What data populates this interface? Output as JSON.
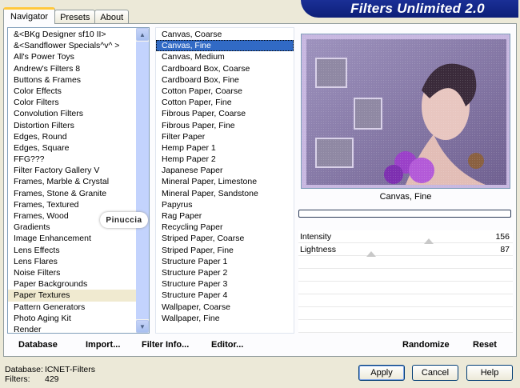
{
  "tabs": [
    {
      "label": "Navigator",
      "active": true
    },
    {
      "label": "Presets",
      "active": false
    },
    {
      "label": "About",
      "active": false
    }
  ],
  "banner": {
    "title": "Filters Unlimited 2.0"
  },
  "categories": {
    "items": [
      "&<BKg Designer sf10 II>",
      "&<Sandflower Specials^v^ >",
      "All's Power Toys",
      "Andrew's Filters 8",
      "Buttons & Frames",
      "Color Effects",
      "Color Filters",
      "Convolution Filters",
      "Distortion Filters",
      "Edges, Round",
      "Edges, Square",
      "FFG???",
      "Filter Factory Gallery V",
      "Frames, Marble & Crystal",
      "Frames, Stone & Granite",
      "Frames, Textured",
      "Frames, Wood",
      "Gradients",
      "Image Enhancement",
      "Lens Effects",
      "Lens Flares",
      "Noise Filters",
      "Paper Backgrounds",
      "Paper Textures",
      "Pattern Generators",
      "Photo Aging Kit",
      "Render"
    ],
    "selected_index": 23
  },
  "filters": {
    "items": [
      "Canvas, Coarse",
      "Canvas, Fine",
      "Canvas, Medium",
      "Cardboard Box, Coarse",
      "Cardboard Box, Fine",
      "Cotton Paper, Coarse",
      "Cotton Paper, Fine",
      "Fibrous Paper, Coarse",
      "Fibrous Paper, Fine",
      "Filter Paper",
      "Hemp Paper 1",
      "Hemp Paper 2",
      "Japanese Paper",
      "Mineral Paper, Limestone",
      "Mineral Paper, Sandstone",
      "Papyrus",
      "Rag Paper",
      "Recycling Paper",
      "Striped Paper, Coarse",
      "Striped Paper, Fine",
      "Structure Paper 1",
      "Structure Paper 2",
      "Structure Paper 3",
      "Structure Paper 4",
      "Wallpaper, Coarse",
      "Wallpaper, Fine"
    ],
    "selected_index": 1
  },
  "preview": {
    "caption": "Canvas, Fine",
    "progress_fraction": 0
  },
  "sliders": [
    {
      "label": "Intensity",
      "value": "156",
      "fraction": 0.61
    },
    {
      "label": "Lightness",
      "value": "87",
      "fraction": 0.34
    }
  ],
  "toolbar": {
    "database": "Database",
    "import": "Import...",
    "filter_info": "Filter Info...",
    "editor": "Editor...",
    "randomize": "Randomize",
    "reset": "Reset"
  },
  "status": {
    "database_label": "Database:",
    "database_value": "ICNET-Filters",
    "filters_label": "Filters:",
    "filters_value": "429"
  },
  "buttons": {
    "apply": "Apply",
    "cancel": "Cancel",
    "help": "Help"
  },
  "watermark": "Pinuccia",
  "colors": {
    "banner": "#0d1f78",
    "selection": "#316ac5",
    "preview_bg": "#8a7aa8"
  }
}
